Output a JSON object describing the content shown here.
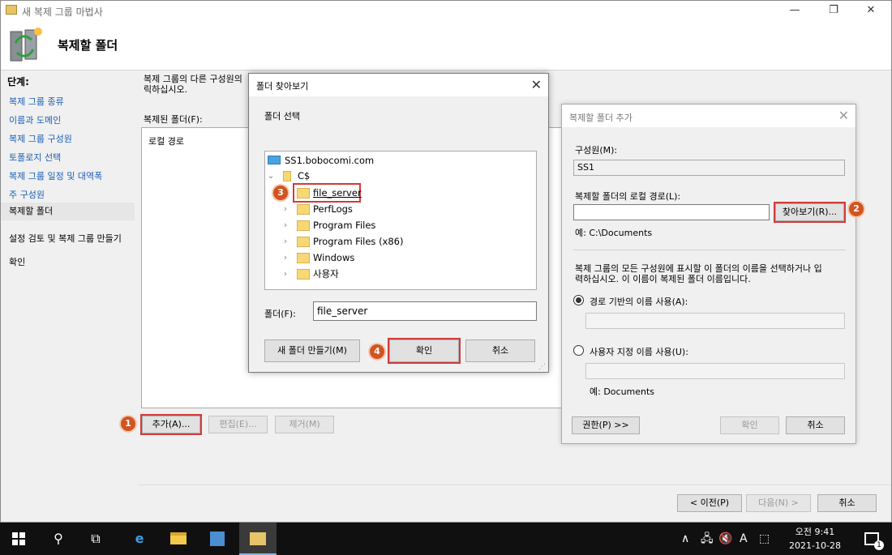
{
  "wizard": {
    "title": "새 복제 그룹 마법사",
    "heading": "복제할 폴더",
    "nav_header": "단계:",
    "nav_items": [
      "복제 그룹 종류",
      "이름과 도메인",
      "복제 그룹 구성원",
      "토폴로지 선택",
      "복제 그룹 일정 및 대역폭",
      "주 구성원",
      "복제할 폴더",
      "설정 검토 및 복제 그룹 만들기",
      "확인"
    ],
    "description": "복제 그룹의 다른 구성원의 · 릭하십시오.",
    "description_line1": "복제 그룹의 다른 구성원의",
    "description_line2": "릭하십시오.",
    "replicated_label": "복제된 폴더(F):",
    "column_local_path": "로컬 경로",
    "add_button": "추가(A)...",
    "edit_button": "편집(E)...",
    "remove_button": "제거(M)",
    "prev_button": "< 이전(P)",
    "next_button": "다음(N) >",
    "cancel_button": "취소",
    "minimize": "—",
    "restore": "❐",
    "close": "✕"
  },
  "browse_dialog": {
    "title": "폴더 찾아보기",
    "select_label": "폴더 선택",
    "tree": [
      {
        "label": "SS1.bobocomi.com",
        "type": "computer"
      },
      {
        "label": "C$",
        "type": "drive"
      },
      {
        "label": "file_server",
        "type": "folder"
      },
      {
        "label": "PerfLogs",
        "type": "folder"
      },
      {
        "label": "Program Files",
        "type": "folder"
      },
      {
        "label": "Program Files (x86)",
        "type": "folder"
      },
      {
        "label": "Windows",
        "type": "folder"
      },
      {
        "label": "사용자",
        "type": "folder"
      }
    ],
    "folder_label": "폴더(F):",
    "folder_value": "file_server",
    "new_folder_button": "새 폴더 만들기(M)",
    "ok_button": "확인",
    "cancel_button": "취소"
  },
  "add_dialog": {
    "title": "복제할 폴더 추가",
    "member_label": "구성원(M):",
    "member_value": "SS1",
    "local_path_label": "복제할 폴더의 로컬 경로(L):",
    "browse_button": "찾아보기(R)...",
    "path_example": "예: C:\\Documents",
    "name_desc_line1": "복제 그룹의 모든 구성원에 표시할 이 폴더의 이름을 선택하거나 입",
    "name_desc_line2": "력하십시오. 이 이름이 복제된 폴더 이름입니다.",
    "radio_path_name": "경로 기반의 이름 사용(A):",
    "radio_custom_name": "사용자 지정 이름 사용(U):",
    "name_example": "예: Documents",
    "permissions_button": "권한(P) >>",
    "ok_button": "확인",
    "cancel_button": "취소"
  },
  "badges": [
    "1",
    "2",
    "3",
    "4"
  ],
  "taskbar": {
    "ampm_time": "오전 9:41",
    "date": "2021-10-28",
    "ime": "A",
    "notification_count": "1"
  },
  "colors": {
    "highlight": "#d23b3b",
    "badge": "#d2541f",
    "link": "#1a5fb4"
  }
}
